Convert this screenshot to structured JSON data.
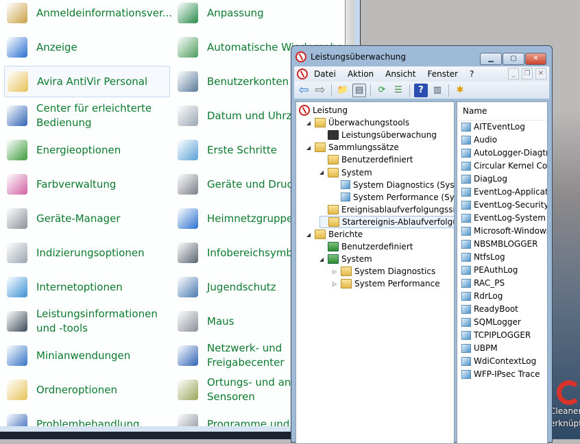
{
  "control_panel": {
    "left": [
      {
        "label": "Anmeldeinformationsver...",
        "icon": "credential-vault-icon",
        "color": "#c9a045"
      },
      {
        "label": "Anzeige",
        "icon": "display-icon",
        "color": "#2a6fd0"
      },
      {
        "label": "Avira AntiVir Personal",
        "icon": "folder-icon",
        "color": "#e8c35a"
      },
      {
        "label": "Center für erleichterte\nBedienung",
        "icon": "ease-of-access-icon",
        "color": "#2f62b5"
      },
      {
        "label": "Energieoptionen",
        "icon": "power-options-icon",
        "color": "#3c9b3c"
      },
      {
        "label": "Farbverwaltung",
        "icon": "color-management-icon",
        "color": "#d05fa0"
      },
      {
        "label": "Geräte-Manager",
        "icon": "device-manager-icon",
        "color": "#8a8f99"
      },
      {
        "label": "Indizierungsoptionen",
        "icon": "indexing-icon",
        "color": "#9aa5b1"
      },
      {
        "label": "Internetoptionen",
        "icon": "internet-options-icon",
        "color": "#3a8fd6"
      },
      {
        "label": "Leistungsinformationen\nund -tools",
        "icon": "performance-icon",
        "color": "#3b4a57"
      },
      {
        "label": "Minianwendungen",
        "icon": "gadgets-icon",
        "color": "#3474c6"
      },
      {
        "label": "Ordneroptionen",
        "icon": "folder-options-icon",
        "color": "#e8c35a"
      },
      {
        "label": "Problembehandlung",
        "icon": "troubleshooting-icon",
        "color": "#2c5fb8"
      }
    ],
    "right": [
      {
        "label": "Anpassung",
        "icon": "personalization-icon",
        "color": "#2a8a4a"
      },
      {
        "label": "Automatische Wiedergabe",
        "icon": "autoplay-icon",
        "color": "#4a9a5a"
      },
      {
        "label": "Benutzerkonten",
        "icon": "user-accounts-icon",
        "color": "#5a7a9a"
      },
      {
        "label": "Datum und Uhrzeit",
        "icon": "clock-icon",
        "color": "#9aa5b1"
      },
      {
        "label": "Erste Schritte",
        "icon": "getting-started-icon",
        "color": "#5aa0d6"
      },
      {
        "label": "Geräte und Drucker",
        "icon": "printer-icon",
        "color": "#7a7f88"
      },
      {
        "label": "Heimnetzgruppe",
        "icon": "homegroup-icon",
        "color": "#2a6fd0"
      },
      {
        "label": "Infobereichsymbole",
        "icon": "notification-area-icon",
        "color": "#5a6470"
      },
      {
        "label": "Jugendschutz",
        "icon": "parental-controls-icon",
        "color": "#4a7ab0"
      },
      {
        "label": "Maus",
        "icon": "mouse-icon",
        "color": "#8a8f99"
      },
      {
        "label": "Netzwerk- und\nFreigabecenter",
        "icon": "network-icon",
        "color": "#2f62b5"
      },
      {
        "label": "Ortungs- und andere\nSensoren",
        "icon": "location-sensors-icon",
        "color": "#9aa55a"
      },
      {
        "label": "Programme und Funktionen",
        "icon": "programs-icon",
        "color": "#8a8f99"
      }
    ]
  },
  "window": {
    "title": "Leistungsüberwachung",
    "menu": [
      "Datei",
      "Aktion",
      "Ansicht",
      "Fenster",
      "?"
    ],
    "toolbar": [
      "back-icon",
      "forward-icon",
      "up-folder-icon",
      "show-hide-tree-icon",
      "refresh-icon",
      "export-list-icon",
      "help-icon",
      "show-action-pane-icon",
      "new-data-collector-icon"
    ],
    "tree": [
      {
        "label": "Leistung",
        "level": 0,
        "arrow": "",
        "icon": "perfmon-icon"
      },
      {
        "label": "Überwachungstools",
        "level": 1,
        "arrow": "◢",
        "icon": "folder-icon"
      },
      {
        "label": "Leistungsüberwachung",
        "level": 2,
        "arrow": "",
        "icon": "monitor-graph-icon"
      },
      {
        "label": "Sammlungssätze",
        "level": 1,
        "arrow": "◢",
        "icon": "folder-icon"
      },
      {
        "label": "Benutzerdefiniert",
        "level": 2,
        "arrow": "",
        "icon": "folder-user-icon"
      },
      {
        "label": "System",
        "level": 2,
        "arrow": "◢",
        "icon": "folder-system-icon"
      },
      {
        "label": "System Diagnostics (System)",
        "level": 3,
        "arrow": "",
        "icon": "cube-icon"
      },
      {
        "label": "System Performance (System)",
        "level": 3,
        "arrow": "",
        "icon": "cube-icon"
      },
      {
        "label": "Ereignisablaufverfolgungssitzungen",
        "level": 2,
        "arrow": "",
        "icon": "folder-trace-icon"
      },
      {
        "label": "Startereignis-Ablaufverfolgungssitzungen",
        "level": 2,
        "arrow": "",
        "icon": "folder-trace-icon",
        "selected": true
      },
      {
        "label": "Berichte",
        "level": 1,
        "arrow": "◢",
        "icon": "folder-report-icon"
      },
      {
        "label": "Benutzerdefiniert",
        "level": 2,
        "arrow": "",
        "icon": "report-user-icon"
      },
      {
        "label": "System",
        "level": 2,
        "arrow": "◢",
        "icon": "report-system-icon"
      },
      {
        "label": "System Diagnostics",
        "level": 3,
        "arrow": "▷",
        "icon": "folder-report-icon"
      },
      {
        "label": "System Performance",
        "level": 3,
        "arrow": "▷",
        "icon": "folder-report-icon"
      }
    ],
    "list_header": "Name",
    "list": [
      "AITEventLog",
      "Audio",
      "AutoLogger-Diagtrack-Listener",
      "Circular Kernel Context Logger",
      "DiagLog",
      "EventLog-Application",
      "EventLog-Security",
      "EventLog-System",
      "Microsoft-Windows-Setup",
      "NBSMBLOGGER",
      "NtfsLog",
      "PEAuthLog",
      "RAC_PS",
      "RdrLog",
      "ReadyBoot",
      "SQMLogger",
      "TCPIPLOGGER",
      "UBPM",
      "WdiContextLog",
      "WFP-IPsec Trace"
    ]
  },
  "desktop": {
    "shortcut_label": "Cleaner.\nerknüpf"
  }
}
